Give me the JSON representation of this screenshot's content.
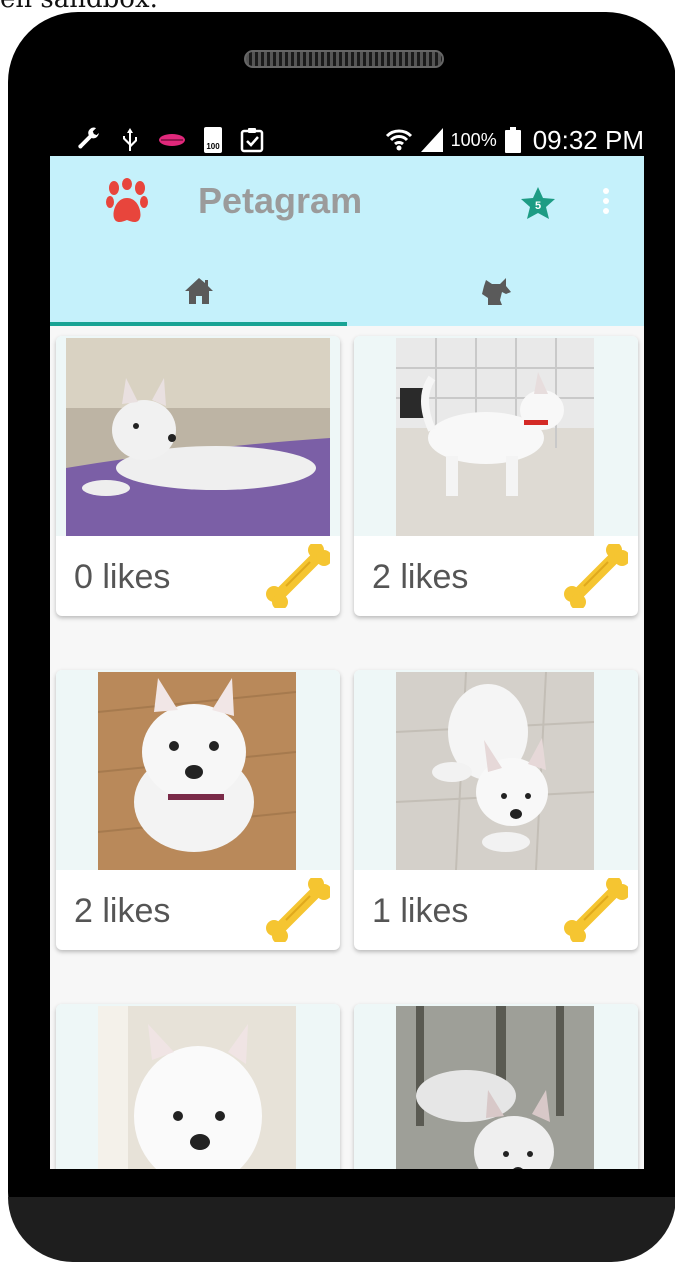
{
  "caption": "en sandbox.",
  "status_bar": {
    "battery_badge": "100",
    "battery_percent": "100%",
    "time": "09:32 PM"
  },
  "app_bar": {
    "title": "Petagram",
    "favorites_count": "5"
  },
  "tabs": [
    {
      "name": "home",
      "icon": "home-icon",
      "selected": true
    },
    {
      "name": "dog",
      "icon": "dog-icon",
      "selected": false
    }
  ],
  "pets": [
    {
      "likes": "0 likes"
    },
    {
      "likes": "2 likes"
    },
    {
      "likes": "2 likes"
    },
    {
      "likes": "1 likes"
    },
    {
      "likes": ""
    },
    {
      "likes": ""
    }
  ],
  "colors": {
    "app_bar": "#c5f1fb",
    "tab_indicator": "#18a394",
    "paw": "#e8453c",
    "star": "#1d9c84",
    "bone": "#f5c531"
  }
}
